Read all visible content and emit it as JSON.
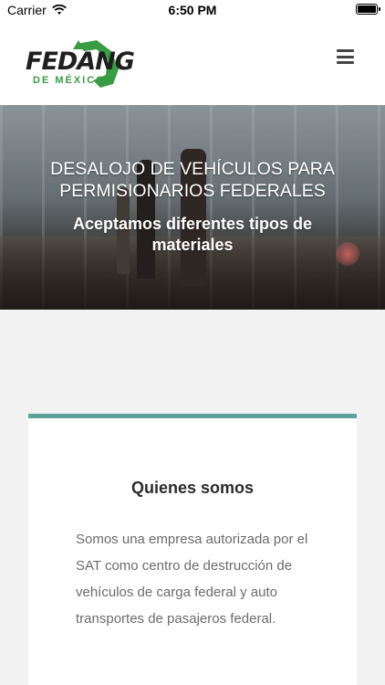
{
  "status_bar": {
    "carrier": "Carrier",
    "time": "6:50 PM"
  },
  "header": {
    "logo_text": "FEDANG",
    "logo_subtext": "DE MÉXICO",
    "menu_icon": "hamburger-icon"
  },
  "hero": {
    "title": "DESALOJO DE VEHÍCULOS PARA PERMISIONARIOS FEDERALES",
    "subtitle": "Aceptamos diferentes tipos de materiales"
  },
  "about": {
    "title": "Quienes somos",
    "text": "Somos una empresa autorizada por el SAT como centro de destrucción de vehículos de carga federal y auto transportes de pasajeros federal."
  },
  "colors": {
    "accent": "#5aa39a",
    "logo_green": "#3a9b45"
  }
}
